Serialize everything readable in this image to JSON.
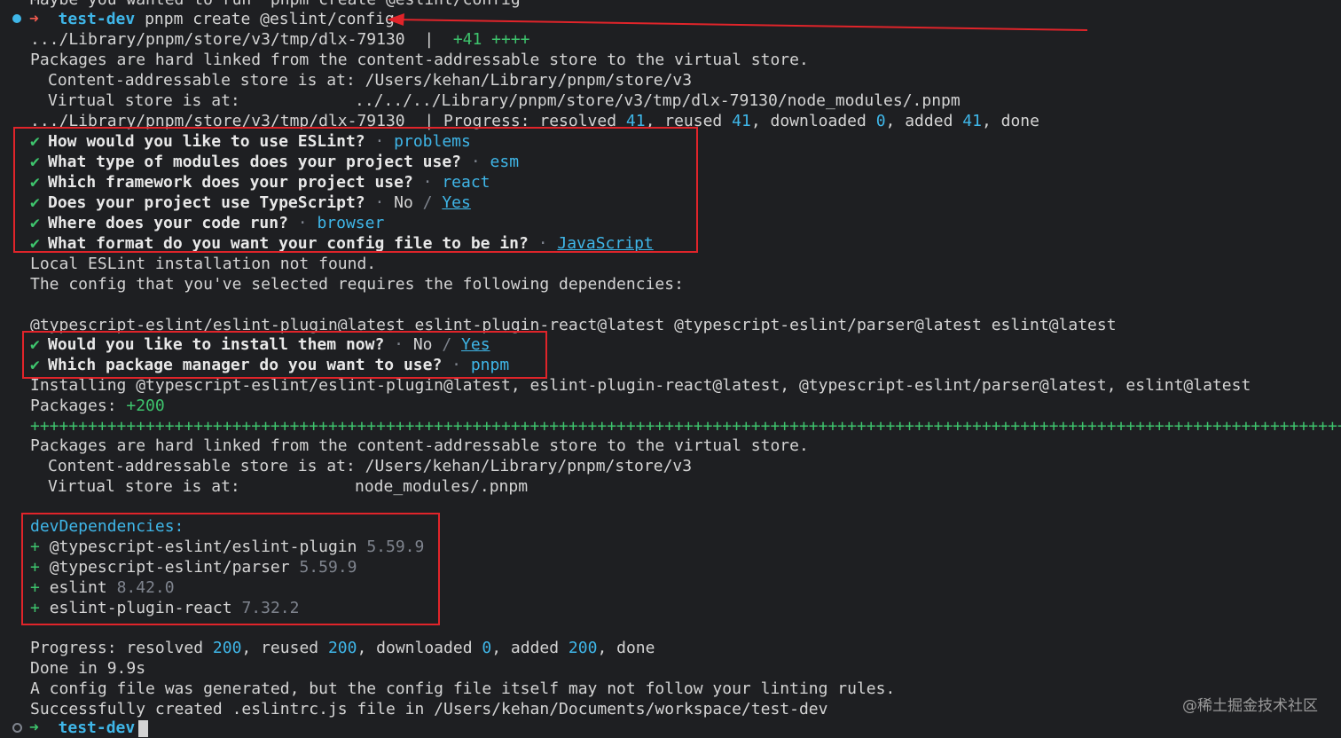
{
  "lines": {
    "top_cut": "Maybe you wanted to run `pnpm create @eslint/config`",
    "dlx_path1": ".../Library/pnpm/store/v3/tmp/dlx-79130",
    "dlx_sep": "  |  ",
    "dlx_added": "+41 ++++",
    "hard_linked": "Packages are hard linked from the content-addressable store to the virtual store.",
    "cas_label": "Content-addressable store is at:",
    "cas_path": " /Users/kehan/Library/pnpm/store/v3",
    "vs_label": "Virtual store is at:",
    "vs_path1": "../../../Library/pnpm/store/v3/tmp/dlx-79130/node_modules/.pnpm",
    "progress1_prefix": ".../Library/pnpm/store/v3/tmp/dlx-79130  | Progress: resolved ",
    "progress1_resolved": "41",
    "progress1_reused_label": ", reused ",
    "progress1_reused": "41",
    "progress1_downloaded_label": ", downloaded ",
    "progress1_downloaded": "0",
    "progress1_added_label": ", added ",
    "progress1_added": "41",
    "progress1_done": ", done",
    "local_not_found": "Local ESLint installation not found.",
    "requires_deps": "The config that you've selected requires the following dependencies:",
    "deps_list": "@typescript-eslint/eslint-plugin@latest eslint-plugin-react@latest @typescript-eslint/parser@latest eslint@latest",
    "installing": "Installing @typescript-eslint/eslint-plugin@latest, eslint-plugin-react@latest, @typescript-eslint/parser@latest, eslint@latest",
    "packages_label": "Packages: ",
    "packages_count": "+200",
    "plus_bar": "++++++++++++++++++++++++++++++++++++++++++++++++++++++++++++++++++++++++++++++++++++++++++++++++++++++++++++++++++++++++++++++++++++++++++++++++++++++++++++++++++++++++++++++++++++++++++++++++++++++++",
    "vs_path2": "node_modules/.pnpm",
    "devdeps_header": "devDependencies:",
    "progress2_label": "Progress: resolved ",
    "progress2_resolved": "200",
    "progress2_reused_label": ", reused ",
    "progress2_reused": "200",
    "progress2_downloaded_label": ", downloaded ",
    "progress2_downloaded": "0",
    "progress2_added_label": ", added ",
    "progress2_added": "200",
    "progress2_done": ", done",
    "done_in": "Done in 9.9s",
    "config_generated": "A config file was generated, but the config file itself may not follow your linting rules.",
    "success": "Successfully created .eslintrc.js file in /Users/kehan/Documents/workspace/test-dev"
  },
  "prompt": {
    "arrow": "➜",
    "dir": "test-dev",
    "command": "pnpm create @eslint/config"
  },
  "questions": [
    {
      "q": "How would you like to use ESLint?",
      "a": "problems"
    },
    {
      "q": "What type of modules does your project use?",
      "a": "esm"
    },
    {
      "q": "Which framework does your project use?",
      "a": "react"
    },
    {
      "q": "Does your project use TypeScript?",
      "no": "No",
      "slash": " / ",
      "a": "Yes"
    },
    {
      "q": "Where does your code run?",
      "a": "browser"
    },
    {
      "q": "What format do you want your config file to be in?",
      "a": "JavaScript"
    },
    {
      "q": "Would you like to install them now?",
      "no": "No",
      "slash": " / ",
      "a": "Yes"
    },
    {
      "q": "Which package manager do you want to use?",
      "a": "pnpm"
    }
  ],
  "question_sep": " · ",
  "check": "✔",
  "devdeps": [
    {
      "name": "@typescript-eslint/eslint-plugin",
      "version": "5.59.9"
    },
    {
      "name": "@typescript-eslint/parser",
      "version": "5.59.9"
    },
    {
      "name": "eslint",
      "version": "8.42.0"
    },
    {
      "name": "eslint-plugin-react",
      "version": "7.32.2"
    }
  ],
  "plus_sign": "+",
  "watermark": "@稀土掘金技术社区",
  "colors": {
    "background": "#1e1f22",
    "text": "#d4d4d4",
    "accent_cyan": "#3fb6e8",
    "green": "#3ec46d",
    "annotation_red": "#e0242a",
    "prompt_dot_active": "#3fb6e8"
  }
}
